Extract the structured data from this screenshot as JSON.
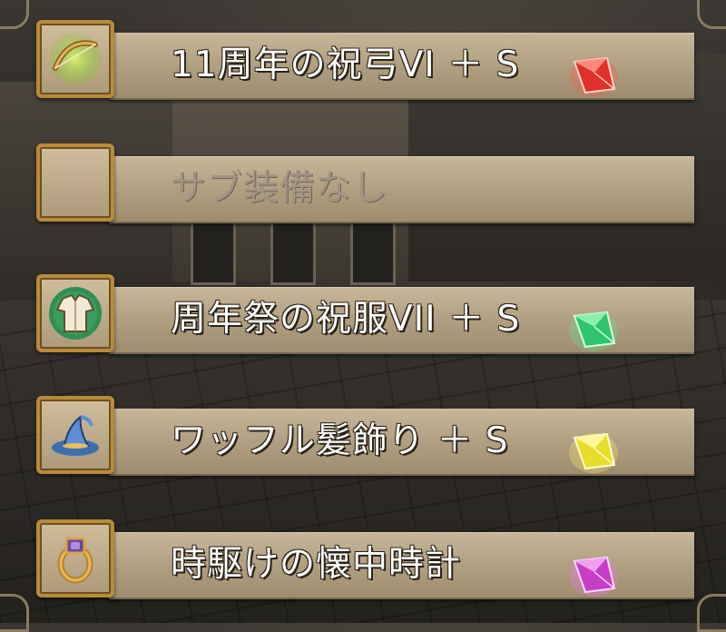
{
  "equipment": [
    {
      "name": "11周年の祝弓VI ＋ S",
      "icon": "bow-icon",
      "gem_color": "#e0302a",
      "glow": "#7dc32b",
      "empty": false
    },
    {
      "name": "サブ装備なし",
      "icon": "empty-slot",
      "gem_color": "",
      "glow": "",
      "empty": true
    },
    {
      "name": "周年祭の祝服VII ＋ S",
      "icon": "robe-icon",
      "gem_color": "#2fc46b",
      "glow": "#2f8f55",
      "empty": false
    },
    {
      "name": "ワッフル髪飾り ＋ S",
      "icon": "wizard-hat-icon",
      "gem_color": "#e8de2a",
      "glow": "#3d6fb0",
      "empty": false
    },
    {
      "name": "時駆けの懐中時計",
      "icon": "ring-icon",
      "gem_color": "#c83ec9",
      "glow": "#6b4aa0",
      "empty": false
    }
  ]
}
